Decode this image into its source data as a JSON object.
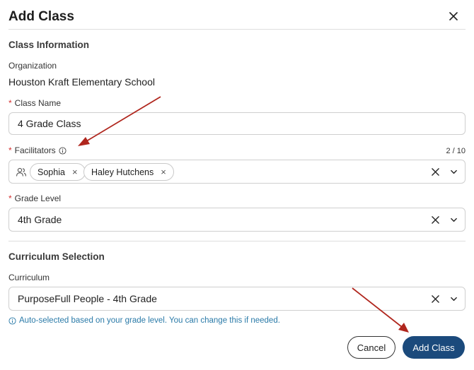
{
  "dialog": {
    "title": "Add Class",
    "close_icon": "close-icon"
  },
  "class_information": {
    "section_title": "Class Information",
    "organization_label": "Organization",
    "organization_value": "Houston Kraft Elementary School",
    "class_name_label": "Class Name",
    "class_name_value": "4 Grade Class",
    "required_mark": "*",
    "facilitators_label": "Facilitators",
    "facilitators_count": "2 / 10",
    "facilitators": [
      "Sophia",
      "Haley Hutchens"
    ],
    "grade_level_label": "Grade Level",
    "grade_level_value": "4th Grade"
  },
  "curriculum_selection": {
    "section_title": "Curriculum Selection",
    "curriculum_label": "Curriculum",
    "curriculum_value": "PurposeFull People - 4th Grade",
    "hint_text": "Auto-selected based on your grade level. You can change this if needed."
  },
  "actions": {
    "cancel_label": "Cancel",
    "add_label": "Add Class"
  },
  "colors": {
    "primary": "#1b4a7c",
    "required": "#d32f2f",
    "hint": "#2a7aa8",
    "annotation_arrow": "#b0261d"
  },
  "chip_remove_glyph": "×"
}
